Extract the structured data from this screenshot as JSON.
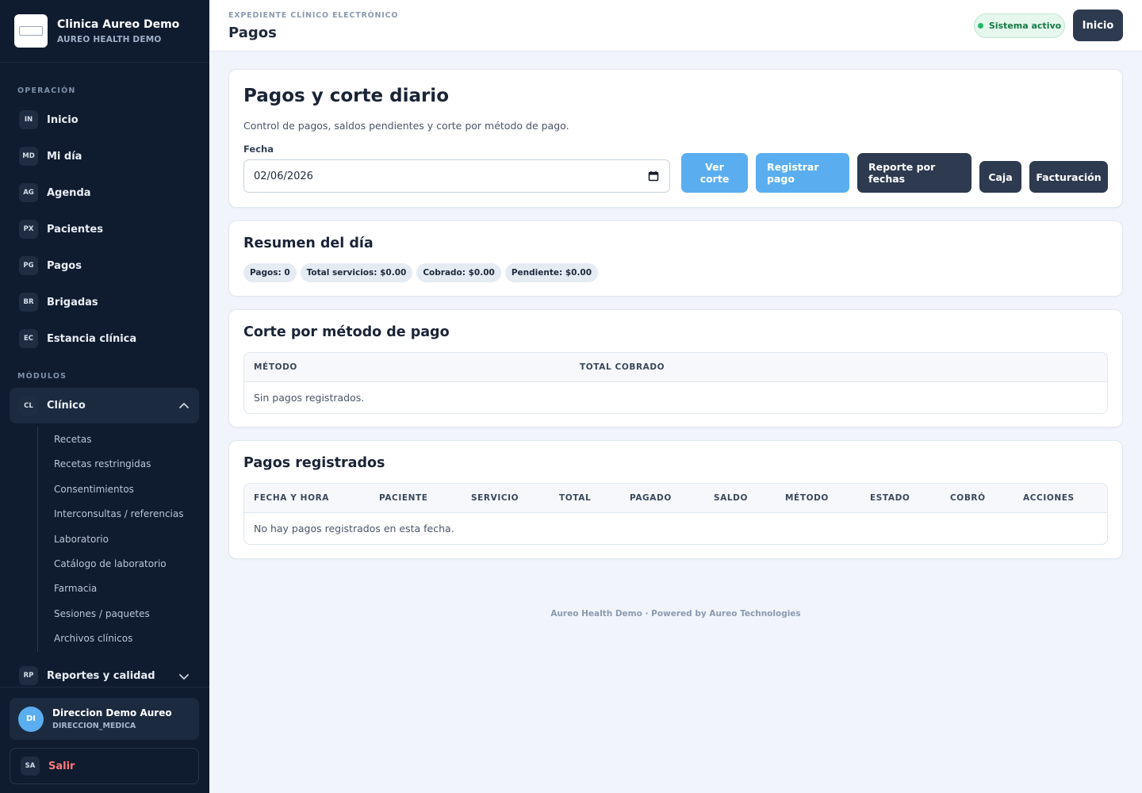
{
  "brand": {
    "title": "Clinica Aureo Demo",
    "subtitle": "AUREO HEALTH DEMO"
  },
  "sidebar": {
    "section_operacion": "OPERACIÓN",
    "section_modulos": "MÓDULOS",
    "items": [
      {
        "badge": "IN",
        "label": "Inicio"
      },
      {
        "badge": "MD",
        "label": "Mi día"
      },
      {
        "badge": "AG",
        "label": "Agenda"
      },
      {
        "badge": "PX",
        "label": "Pacientes"
      },
      {
        "badge": "PG",
        "label": "Pagos"
      },
      {
        "badge": "BR",
        "label": "Brigadas"
      },
      {
        "badge": "EC",
        "label": "Estancia clínica"
      }
    ],
    "clinico": {
      "badge": "CL",
      "label": "Clínico",
      "expanded": true
    },
    "clinico_sub": [
      "Recetas",
      "Recetas restringidas",
      "Consentimientos",
      "Interconsultas / referencias",
      "Laboratorio",
      "Catálogo de laboratorio",
      "Farmacia",
      "Sesiones / paquetes",
      "Archivos clínicos"
    ],
    "reportes": {
      "badge": "RP",
      "label": "Reportes y calidad",
      "expanded": false
    },
    "user": {
      "initials": "DI",
      "name": "Direccion Demo Aureo",
      "role": "DIRECCION_MEDICA"
    },
    "logout": {
      "badge": "SA",
      "label": "Salir"
    }
  },
  "topbar": {
    "crumb": "EXPEDIENTE CLÍNICO ELECTRÓNICO",
    "title": "Pagos",
    "status": "Sistema activo",
    "home_button": "Inicio"
  },
  "main": {
    "title": "Pagos y corte diario",
    "description": "Control de pagos, saldos pendientes y corte por método de pago.",
    "date_label": "Fecha",
    "date_value": "02/06/2026",
    "buttons": {
      "ver_corte": "Ver corte",
      "registrar_pago": "Registrar pago",
      "reporte_fechas": "Reporte por fechas",
      "caja": "Caja",
      "facturacion": "Facturación"
    },
    "summary": {
      "title": "Resumen del día",
      "chips": [
        "Pagos: 0",
        "Total servicios: $0.00",
        "Cobrado: $0.00",
        "Pendiente: $0.00"
      ]
    },
    "corte": {
      "title": "Corte por método de pago",
      "columns": [
        "MÉTODO",
        "TOTAL COBRADO"
      ],
      "empty": "Sin pagos registrados."
    },
    "registrados": {
      "title": "Pagos registrados",
      "columns": [
        "FECHA Y HORA",
        "PACIENTE",
        "SERVICIO",
        "TOTAL",
        "PAGADO",
        "SALDO",
        "MÉTODO",
        "ESTADO",
        "COBRÓ",
        "ACCIONES"
      ],
      "empty": "No hay pagos registrados en esta fecha."
    }
  },
  "footer": "Aureo Health Demo · Powered by Aureo Technologies",
  "colors": {
    "sidebar_bg": "#0f1b2e",
    "accent_light_blue": "#5aaef0",
    "dark_button": "#2d3a4f",
    "status_green": "#22b868",
    "logout_red": "#ff7a7a"
  }
}
